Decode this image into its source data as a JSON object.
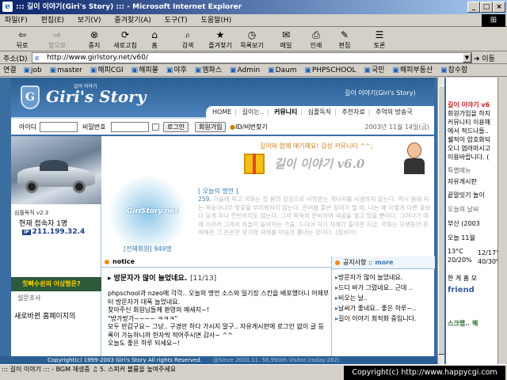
{
  "window": {
    "title": "::: 길이 이야기(Giri's Story) ::: - Microsoft Internet Explorer"
  },
  "menu": [
    "파일(F)",
    "편집(E)",
    "보기(V)",
    "즐겨찾기(A)",
    "도구(T)",
    "도움말(H)"
  ],
  "toolbar": [
    "뒤로",
    "앞으로",
    "중지",
    "새로고침",
    "홈",
    "검색",
    "즐겨찾기",
    "목록보기",
    "메일",
    "인쇄",
    "편집",
    "토론"
  ],
  "address": {
    "label": "주소(D)",
    "url": "http://www.girlstory.net/v60/",
    "go": "이동"
  },
  "links": {
    "label": "연결",
    "items": [
      "job",
      "master",
      "해피CGI",
      "해피몰",
      "야후",
      "엠파스",
      "Admin",
      "Daum",
      "PHPSCHOOL",
      "국민",
      "해피부동산",
      "잡수함"
    ]
  },
  "site": {
    "logo": "Giri's Story",
    "logo_sub": "길이 이야기",
    "tagline": "길이 이야기(Giri's Story)",
    "nav": [
      "HOME",
      "길이는..",
      "커뮤니티",
      "심플독직",
      "추천자료",
      "추억의 방송국"
    ],
    "nav_active": "커뮤니티",
    "login": {
      "id_label": "아이디",
      "pw_label": "비밀번호",
      "login_btn": "로그인",
      "join_btn": "회원가입",
      "find": "ID/비번찾기"
    },
    "date": "2003년 11월 14일(금)",
    "slogan": "길이와 함께 얘기해요! 감성 커뮤니티 ^^;",
    "big_title": "길이 이야기 v6.0",
    "glow_text": "GiriStory.net",
    "members": "[전체회원] 949명",
    "visit_label": "심플독직 v2.3",
    "visit_now": "현재 접속자 1명",
    "ip": "211.199.32.4",
    "ip_tag": "IP",
    "banner": "칫뻐수쉰의 이상형은?",
    "poll_label": "설문조사",
    "poll_question": "새로바뀐 홈페이지의",
    "quote_head": "[ 오늘의 명언 ]",
    "quote_num": "259.",
    "quote_text": "가을에 피고 국화는 첫 봄의 상징으로 사랑받는 개나리를 시샘하지 않는다. 역시 봄에 피는 복숭아나무 벚꽃을 부러워하지 않는다. 한여름 붉은 장미가 필 때, 나는 왜 이렇게 다른 꽃보다 늦게 피나 한탄하지도 않는다. 그저 묵묵히 준비하며 내공을 쌓고 있을 뿐이다. 그러다가 때에 이르러 그제서 하늘이 높아지는 가을, 드디어 자기 차례가 돌아온 지금. 국화는 오랫동안 준비해온 그 은은한 향기와 자태를 마음껏 뽐내는 것이다. (정비아)",
    "notice_label": "notice",
    "notice_title": "방문자가 많이 늘었네요.",
    "notice_date": "[11/13]",
    "notice_body": [
      "phpschool과 nzeo에 각각.. 오늘의 명언 소스와 일기장 스킨을 배포했더니 어제부터 방문자가 대폭 늘었네요.",
      "찾아주신 회원님들께 환영의 메세지~!",
      "\"방가방가~~~~ ㅋㅋㅋ\"",
      "모두 반갑구요~ 그냥.. 구경만 하다 가시지 말구.. 자유게시판에 로그인 없이 글 등록이 가능하니까 한자씩 적어주시면 감사~ ^^",
      "오늘도 좋은 하루 되세요~!"
    ],
    "public_label": "공지사항 ::",
    "public_more": "more",
    "public_list": [
      "방문자가 많이 늘었네요.",
      "드디 바가 그렸네요.. 근데 ..",
      "비오는 날..",
      "날씨가 좋네요.. 좋은 하루~..",
      "길이 이야기 최적화 중입니다."
    ],
    "footer": "Copyright(c) 1999-2003 Giri's Story All rights Reserved.",
    "footer_ver": "@Since 2000.11. 56,990th Visitor.(today:282)"
  },
  "side_window": {
    "lines": [
      "길이 이야기 v6",
      "회원가입을 하지",
      "커뮤니티 이용해",
      "에서 적드나들..",
      "쉘적이 암호화되",
      "오니 염려마시고",
      "이용바랍니다. (",
      "특별메뉴",
      "자유게시판",
      "끝말잇기 놀이",
      "오늘의 날씨",
      "부산 (2003",
      "오늘 11월",
      "13°C",
      "20/20%",
      "12/17°C",
      "40/30%",
      "한 게 홈 모",
      "friend",
      "스크랩.. 해"
    ]
  },
  "status": {
    "line1": "::: 길이 이야기 ::: - BGM 재생중 ♫ 5. 스피커 볼륨을 높여주세요",
    "copyright": "Copyright(c) http://www.happycgi.com"
  }
}
